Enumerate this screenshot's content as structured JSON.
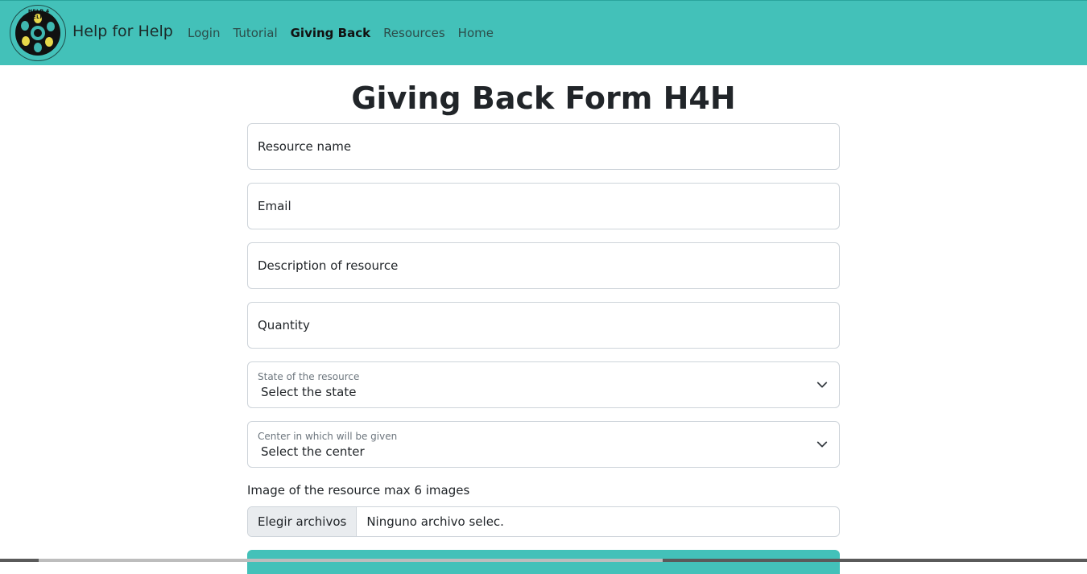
{
  "navbar": {
    "brand": "Help for Help",
    "logo_text": "HELP 4 HELP",
    "links": [
      {
        "label": "Login"
      },
      {
        "label": "Tutorial"
      },
      {
        "label": "Giving Back"
      },
      {
        "label": "Resources"
      },
      {
        "label": "Home"
      }
    ],
    "active_link": "Giving Back"
  },
  "form": {
    "title": "Giving Back Form H4H",
    "resource_name_placeholder": "Resource name",
    "email_placeholder": "Email",
    "description_placeholder": "Description of resource",
    "quantity_placeholder": "Quantity",
    "state_label": "State of the resource",
    "state_value": "Select the state",
    "center_label": "Center in which will be given",
    "center_value": "Select the center",
    "image_label": "Image of the resource max 6 images",
    "file_button": "Elegir archivos",
    "file_status": "Ninguno archivo selec."
  },
  "colors": {
    "navbar_bg": "#43c1b9",
    "border": "#ced4da"
  }
}
